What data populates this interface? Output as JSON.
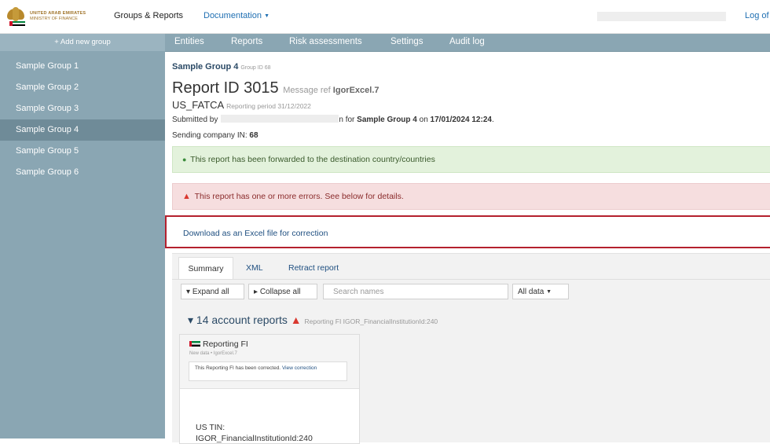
{
  "logo": {
    "line1": "UNITED ARAB EMIRATES",
    "line2": "MINISTRY OF FINANCE"
  },
  "topnav": {
    "groups_reports": "Groups & Reports",
    "documentation": "Documentation",
    "logoff": "Log of"
  },
  "sidebar": {
    "add_group": "+ Add new group",
    "items": [
      {
        "label": "Sample Group 1"
      },
      {
        "label": "Sample Group 2"
      },
      {
        "label": "Sample Group 3"
      },
      {
        "label": "Sample Group 4"
      },
      {
        "label": "Sample Group 5"
      },
      {
        "label": "Sample Group 6"
      }
    ],
    "active_index": 3
  },
  "subnav": {
    "items": [
      {
        "label": "Entities"
      },
      {
        "label": "Reports"
      },
      {
        "label": "Risk assessments"
      },
      {
        "label": "Settings"
      },
      {
        "label": "Audit log"
      }
    ]
  },
  "report": {
    "group_name": "Sample Group 4",
    "group_id": "Group ID 68",
    "title": "Report ID 3015",
    "msg_prefix": "Message ref",
    "msg_ref": "IgorExcel.7",
    "regime": "US_FATCA",
    "period": "Reporting period 31/12/2022",
    "submitted_prefix": "Submitted by",
    "submitted_mid": "n for",
    "submitted_group": "Sample Group 4",
    "submitted_on": "on",
    "submitted_date": "17/01/2024 12:24",
    "submitted_end": ".",
    "sending_label": "Sending company IN:",
    "sending_value": "68"
  },
  "alerts": {
    "success": "This report has been forwarded to the destination country/countries",
    "error": "This report has one or more errors. See below for details."
  },
  "download": {
    "label": "Download as an Excel file for correction"
  },
  "tabs": {
    "summary": "Summary",
    "xml": "XML",
    "retract": "Retract report"
  },
  "toolbar": {
    "expand": "Expand all",
    "collapse": "Collapse all",
    "search_placeholder": "Search names",
    "all_data": "All data"
  },
  "accounts": {
    "count_label": "14 account reports",
    "fi_label": "Reporting FI IGOR_FinancialInstitutionId:240"
  },
  "card": {
    "title": "Reporting FI",
    "subtitle": "New data • IgorExcel.7",
    "note": "This Reporting FI has been corrected.",
    "view": "View correction",
    "tin_label": "US TIN:",
    "tin_value": "IGOR_FinancialInstitutionId:240"
  },
  "colors": {
    "sidebar": "#8aa6b3",
    "sidebar_active": "#6f8b98",
    "success_bg": "#e3f2dc",
    "error_bg": "#f6dedf",
    "highlight_border": "#b4212e",
    "link": "#1f4f80"
  }
}
